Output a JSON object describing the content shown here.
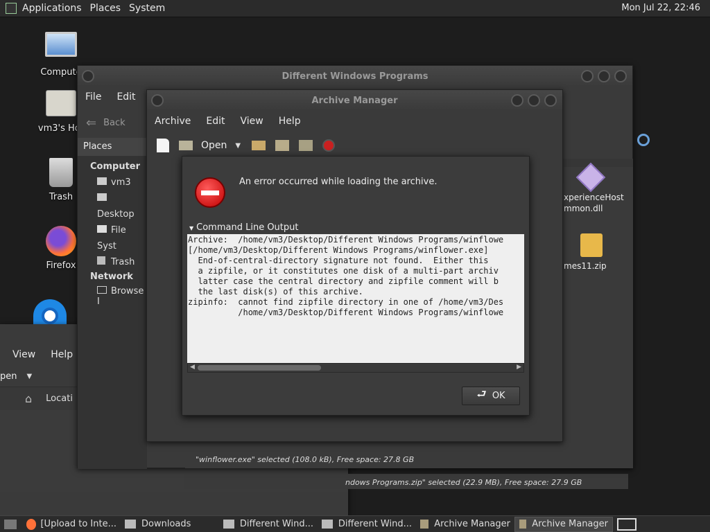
{
  "topbar": {
    "applications": "Applications",
    "places": "Places",
    "system": "System",
    "clock": "Mon Jul 22, 22:46"
  },
  "desktop": {
    "computer": "Compute",
    "home": "vm3's Hor",
    "trash": "Trash",
    "firefox": "Firefox"
  },
  "back_window": {
    "view": "View",
    "help": "Help",
    "open": "pen",
    "location": "Locati",
    "status": "ndows Programs.zip\" selected (22.9 MB), Free space: 27.9 GB"
  },
  "caja": {
    "title": "Different Windows Programs",
    "menu": {
      "file": "File",
      "edit": "Edit",
      "view": "V"
    },
    "back": "Back",
    "places_label": "Places",
    "sidebar": {
      "computer_header": "Computer",
      "items": [
        "vm3",
        "Desktop",
        "File Syst",
        "Trash"
      ],
      "network_header": "Network",
      "browse": "Browse I"
    },
    "files": [
      {
        "name": "xperienceHost\nmmon.dll"
      },
      {
        "name": "mes11.zip"
      }
    ],
    "status": "\"winflower.exe\" selected (108.0 kB), Free space: 27.8 GB"
  },
  "archive_manager": {
    "title": "Archive Manager",
    "menu": {
      "archive": "Archive",
      "edit": "Edit",
      "view": "View",
      "help": "Help"
    },
    "open": "Open"
  },
  "dialog": {
    "message": "An error occurred while loading the archive.",
    "expander": "Command Line Output",
    "output": "Archive:  /home/vm3/Desktop/Different Windows Programs/winflowe\n[/home/vm3/Desktop/Different Windows Programs/winflower.exe]\n  End-of-central-directory signature not found.  Either this\n  a zipfile, or it constitutes one disk of a multi-part archiv\n  latter case the central directory and zipfile comment will b\n  the last disk(s) of this archive.\nzipinfo:  cannot find zipfile directory in one of /home/vm3/Des\n          /home/vm3/Desktop/Different Windows Programs/winflowe",
    "ok": "OK"
  },
  "taskbar": {
    "items": [
      "[Upload to Inte...",
      "Downloads",
      "Different Wind...",
      "Different Wind...",
      "Archive Manager",
      "Archive Manager"
    ]
  }
}
